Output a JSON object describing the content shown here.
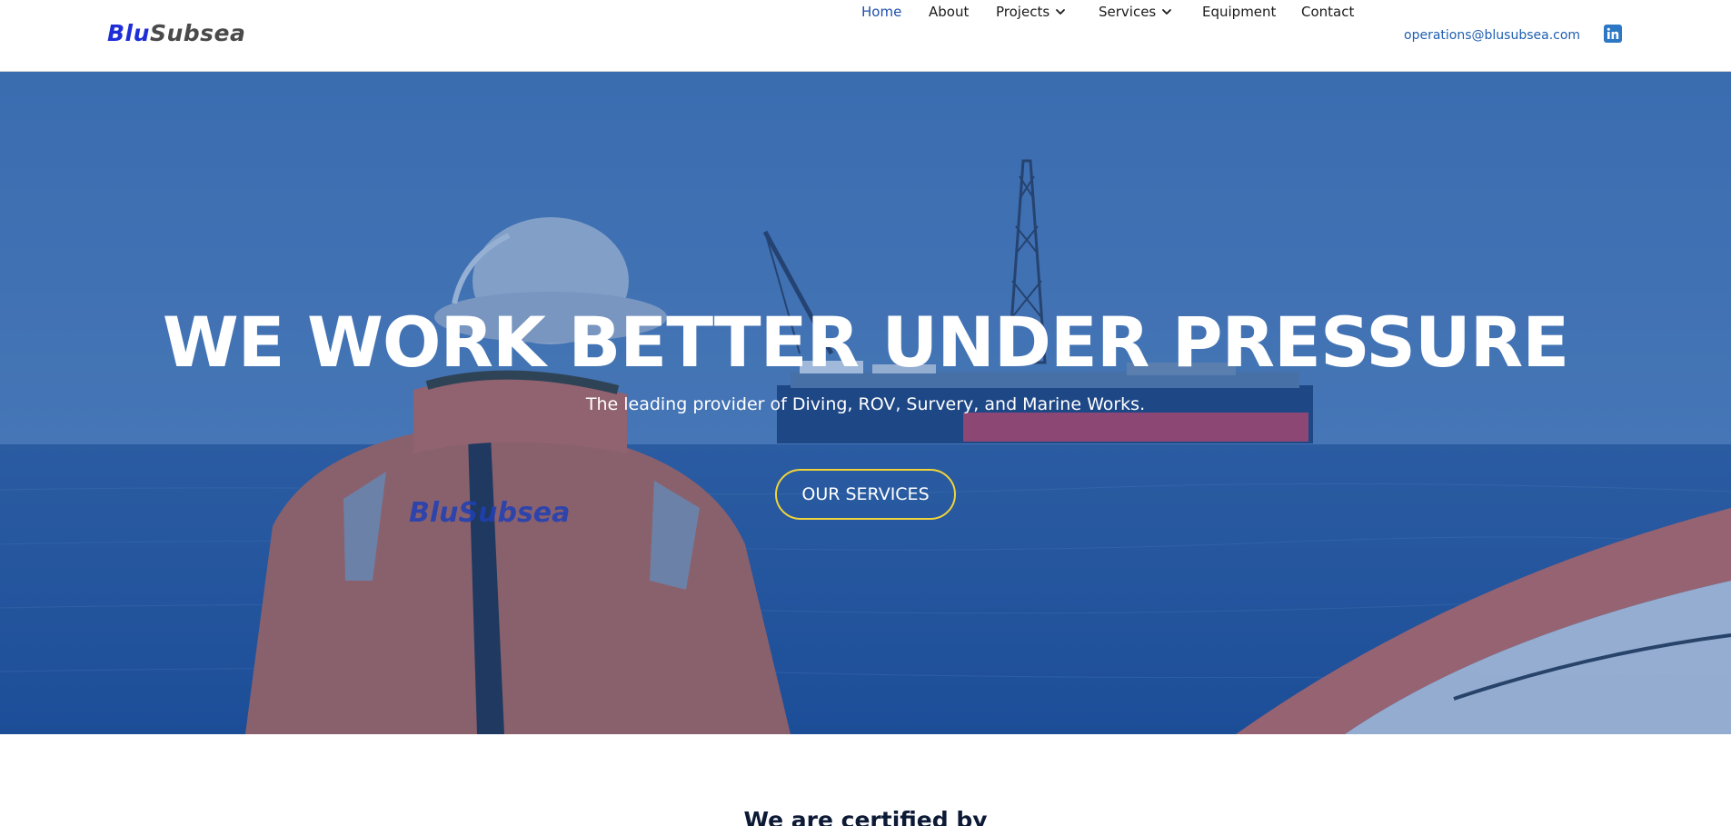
{
  "header": {
    "logo": {
      "part1": "Blu",
      "part2": "Subsea"
    },
    "nav": [
      {
        "label": "Home",
        "active": true
      },
      {
        "label": "About"
      },
      {
        "label": "Projects",
        "dropdown": true
      },
      {
        "label": "Services",
        "dropdown": true
      },
      {
        "label": "Equipment"
      },
      {
        "label": "Contact"
      }
    ],
    "email": "operations@blusubsea.com",
    "social_icon": "linkedin-icon"
  },
  "hero": {
    "title": "WE WORK BETTER UNDER PRESSURE",
    "subtitle": "The leading provider of Diving, ROV, Survery, and Marine Works.",
    "cta_label": "OUR SERVICES",
    "jacket_text": "BluSubsea"
  },
  "certified": {
    "heading": "We are certified by"
  },
  "colors": {
    "brand_blue": "#1f2fd6",
    "nav_active": "#1f4fa8",
    "cta_border": "#f0d43a",
    "hero_overlay": "#1e56a8"
  }
}
